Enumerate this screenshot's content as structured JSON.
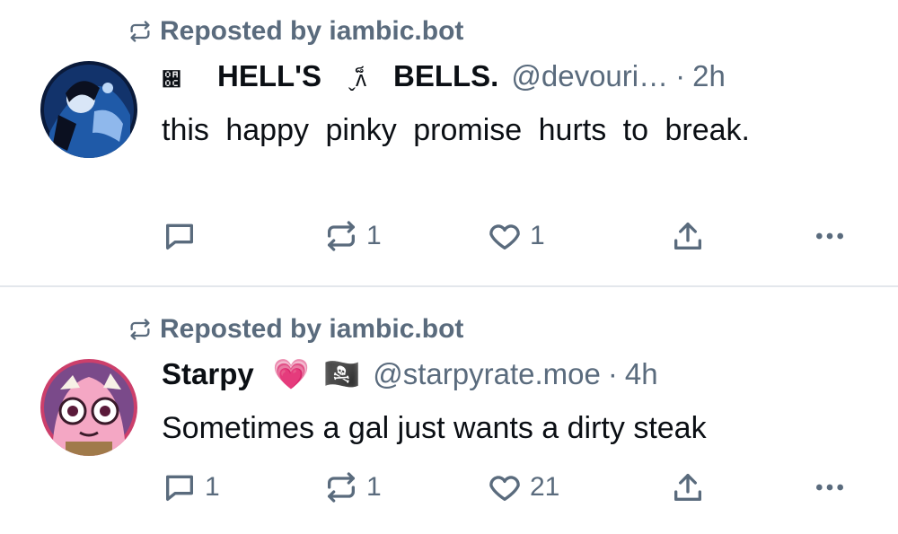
{
  "posts": [
    {
      "repost_label": "Reposted by iambic.bot",
      "name_prefix": "਌",
      "name_part1": "HELL'S",
      "name_mid": "ˬʌ็",
      "name_part2": "BELLS.",
      "handle": "@devouri…",
      "separator": "·",
      "time": "2h",
      "text": "this happy pinky promise hurts to break.",
      "actions": {
        "reply": "",
        "repost": "1",
        "like": "1"
      },
      "avatar": "avatar-anime-dark-blue"
    },
    {
      "repost_label": "Reposted by iambic.bot",
      "name": "Starpy",
      "emoji1": "💗",
      "emoji2": "🏴‍☠️",
      "handle": "@starpyrate.moe",
      "separator": "·",
      "time": "4h",
      "text": "Sometimes a gal just wants a dirty steak",
      "actions": {
        "reply": "1",
        "repost": "1",
        "like": "21"
      },
      "avatar": "avatar-pink-cartoon"
    }
  ],
  "colors": {
    "muted": "#5a6b7d",
    "text": "#0b0f14",
    "divider": "#e3e7ec"
  }
}
